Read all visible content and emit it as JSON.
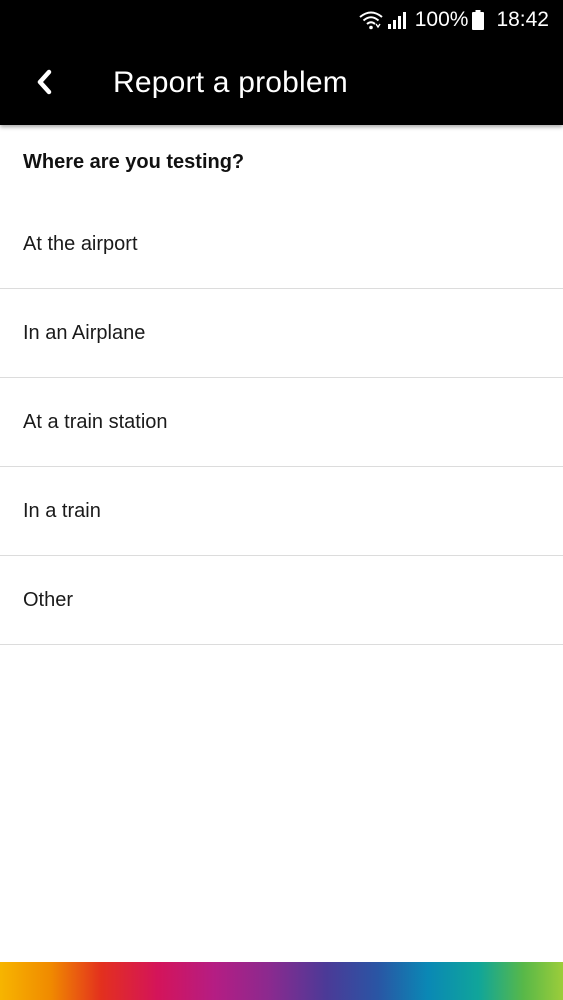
{
  "status_bar": {
    "battery": "100%",
    "time": "18:42",
    "icons": [
      "wifi-icon",
      "signal-icon",
      "battery-icon"
    ]
  },
  "app_bar": {
    "title": "Report a problem",
    "back_icon": "chevron-left-icon"
  },
  "main": {
    "heading": "Where are you testing?",
    "options": [
      "At the airport",
      "In an Airplane",
      "At a train station",
      "In a train",
      "Other"
    ]
  },
  "colors": {
    "app_bar_bg": "#000000",
    "divider": "#dcdcdc",
    "background": "#ffffff"
  }
}
